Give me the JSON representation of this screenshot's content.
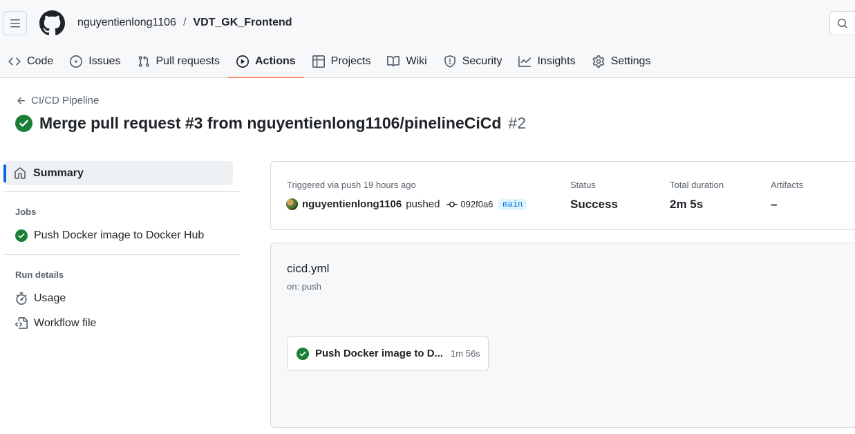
{
  "header": {
    "owner": "nguyentienlong1106",
    "separator": "/",
    "repo": "VDT_GK_Frontend"
  },
  "tabs": [
    {
      "label": "Code",
      "icon": "code-icon"
    },
    {
      "label": "Issues",
      "icon": "issue-icon"
    },
    {
      "label": "Pull requests",
      "icon": "pull-request-icon"
    },
    {
      "label": "Actions",
      "icon": "play-icon",
      "active": true
    },
    {
      "label": "Projects",
      "icon": "table-icon"
    },
    {
      "label": "Wiki",
      "icon": "book-icon"
    },
    {
      "label": "Security",
      "icon": "shield-icon"
    },
    {
      "label": "Insights",
      "icon": "graph-icon"
    },
    {
      "label": "Settings",
      "icon": "gear-icon"
    }
  ],
  "page": {
    "back_label": "CI/CD Pipeline",
    "title": "Merge pull request #3 from nguyentienlong1106/pinelineCiCd",
    "run_number": "#2"
  },
  "sidebar": {
    "summary_label": "Summary",
    "jobs_heading": "Jobs",
    "jobs": [
      {
        "label": "Push Docker image to Docker Hub",
        "status": "success"
      }
    ],
    "run_details_heading": "Run details",
    "usage_label": "Usage",
    "workflow_file_label": "Workflow file"
  },
  "summary": {
    "trigger_label": "Triggered via push 19 hours ago",
    "actor": "nguyentienlong1106",
    "action": "pushed",
    "commit": "092f0a6",
    "branch": "main",
    "status_label": "Status",
    "status_value": "Success",
    "duration_label": "Total duration",
    "duration_value": "2m 5s",
    "artifacts_label": "Artifacts",
    "artifacts_value": "–"
  },
  "workflow": {
    "name": "cicd.yml",
    "trigger": "on: push",
    "job": {
      "label": "Push Docker image to D...",
      "duration": "1m 56s",
      "status": "success"
    }
  },
  "colors": {
    "success": "#1a7f37",
    "active_tab_underline": "#fd8c73",
    "accent": "#0969da"
  }
}
